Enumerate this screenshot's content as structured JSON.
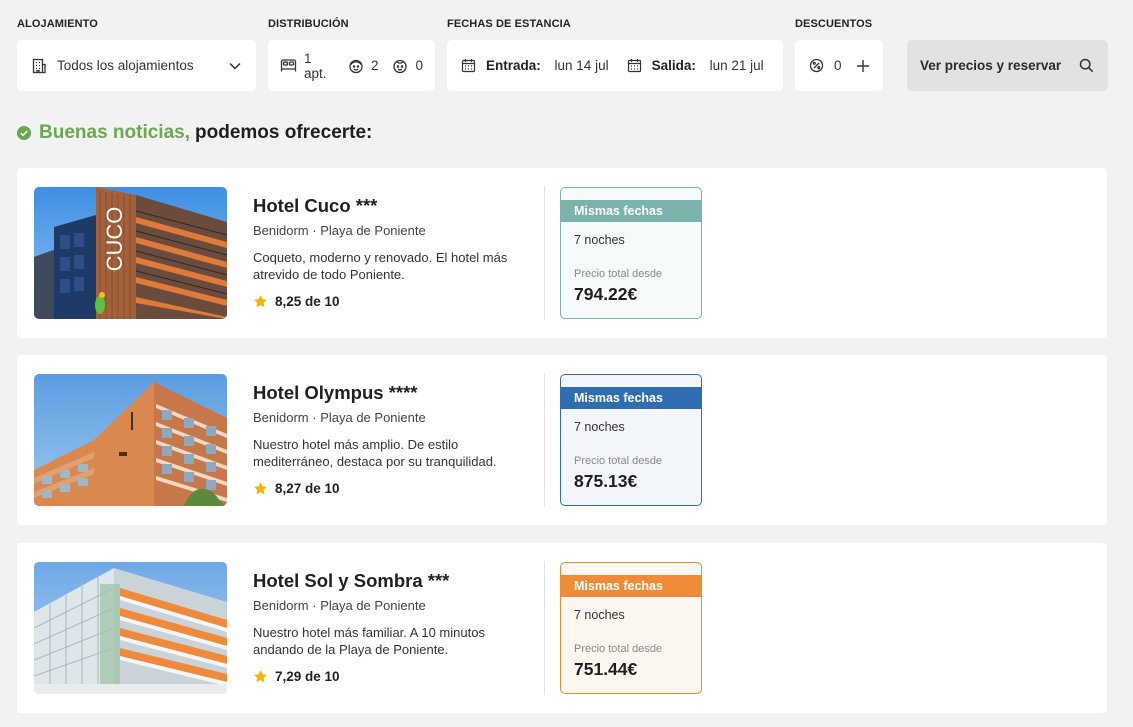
{
  "search": {
    "alojamiento_label": "ALOJAMIENTO",
    "alojamiento_value": "Todos los alojamientos",
    "distribucion_label": "DISTRIBUCIÓN",
    "apartments": "1 apt.",
    "adults": "2",
    "children": "0",
    "fechas_label": "FECHAS DE ESTANCIA",
    "entrada_label": "Entrada:",
    "entrada_value": "lun 14 jul",
    "salida_label": "Salida:",
    "salida_value": "lun 21 jul",
    "descuentos_label": "DESCUENTOS",
    "discount_count": "0",
    "cta_label": "Ver precios y reservar"
  },
  "headline": {
    "good": "Buenas noticias,",
    "rest": "podemos ofrecerte:"
  },
  "colors": {
    "green_ok": "#6aa84f",
    "teal": "#7bb2ab",
    "blue": "#2f6db3",
    "orange": "#ef8a36",
    "star": "#f5b400"
  },
  "hotels": [
    {
      "name": "Hotel Cuco ***",
      "location": "Benidorm · Playa de Poniente",
      "description": "Coqueto, moderno y renovado. El hotel más atrevido de todo Poniente.",
      "rating": "8,25 de 10",
      "price_header": "Mismas fechas",
      "nights": "7 noches",
      "from_label": "Precio total desde",
      "price": "794.22€",
      "accent": "teal"
    },
    {
      "name": "Hotel Olympus ****",
      "location": "Benidorm · Playa de Poniente",
      "description": "Nuestro hotel más amplio. De estilo mediterráneo, destaca por su tranquilidad.",
      "rating": "8,27 de 10",
      "price_header": "Mismas fechas",
      "nights": "7 noches",
      "from_label": "Precio total desde",
      "price": "875.13€",
      "accent": "blue"
    },
    {
      "name": "Hotel Sol y Sombra ***",
      "location": "Benidorm · Playa de Poniente",
      "description": "Nuestro hotel más familiar. A 10 minutos andando de la Playa de Poniente.",
      "rating": "7,29 de 10",
      "price_header": "Mismas fechas",
      "nights": "7 noches",
      "from_label": "Precio total desde",
      "price": "751.44€",
      "accent": "orange"
    }
  ]
}
